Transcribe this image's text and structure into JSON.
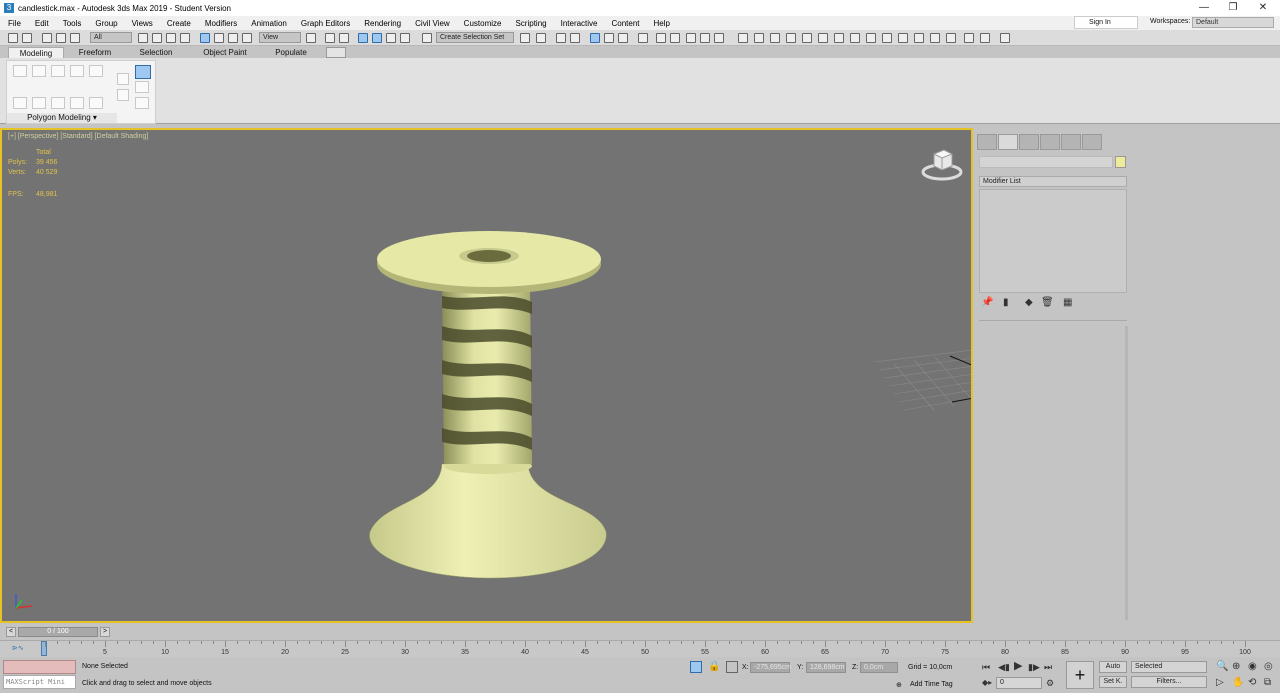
{
  "window": {
    "title": "candlestick.max - Autodesk 3ds Max 2019 - Student Version",
    "app_icon": "3",
    "controls": [
      "—",
      "❐",
      "✕"
    ]
  },
  "menu": [
    "File",
    "Edit",
    "Tools",
    "Group",
    "Views",
    "Create",
    "Modifiers",
    "Animation",
    "Graph Editors",
    "Rendering",
    "Civil View",
    "Customize",
    "Scripting",
    "Interactive",
    "Content",
    "Help"
  ],
  "account": {
    "sign_in": "Sign In",
    "workspaces_label": "Workspaces:",
    "workspace": "Default"
  },
  "toolbar": {
    "selection_filter": "All",
    "ref_coord": "View",
    "selection_set": "Create Selection Set"
  },
  "ribbon": {
    "tabs": [
      "Modeling",
      "Freeform",
      "Selection",
      "Object Paint",
      "Populate"
    ],
    "active_tab": "Modeling",
    "panel_label": "Polygon Modeling ▾"
  },
  "viewport": {
    "label": "[+] [Perspective] [Standard] [Default Shading]",
    "stats": {
      "total_label": "Total",
      "polys_label": "Polys:",
      "polys_value": "39 456",
      "verts_label": "Verts:",
      "verts_value": "40 529",
      "fps_label": "FPS:",
      "fps_value": "48,981"
    },
    "object_color": "#e6e9a6"
  },
  "command_panel": {
    "modifier_list": "Modifier List",
    "swatch_color": "#ecec9a"
  },
  "timeline": {
    "frame_display": "0 / 100",
    "prev": "<",
    "next": ">",
    "ticks": [
      "0",
      "5",
      "10",
      "15",
      "20",
      "25",
      "30",
      "35",
      "40",
      "45",
      "50",
      "55",
      "60",
      "65",
      "70",
      "75",
      "80",
      "85",
      "90",
      "95",
      "100"
    ]
  },
  "status": {
    "maxscript": "MAXScript Mini",
    "selection": "None Selected",
    "prompt": "Click and drag to select and move objects",
    "x_label": "X:",
    "x_value": "-275,695cm",
    "y_label": "Y:",
    "y_value": "128,698cm",
    "z_label": "Z:",
    "z_value": "0,0cm",
    "grid": "Grid = 10,0cm",
    "add_time_tag": "Add Time Tag",
    "auto": "Auto",
    "set_key": "Set K.",
    "key_filter": "Selected",
    "filters": "Filters...",
    "frame": "0"
  }
}
